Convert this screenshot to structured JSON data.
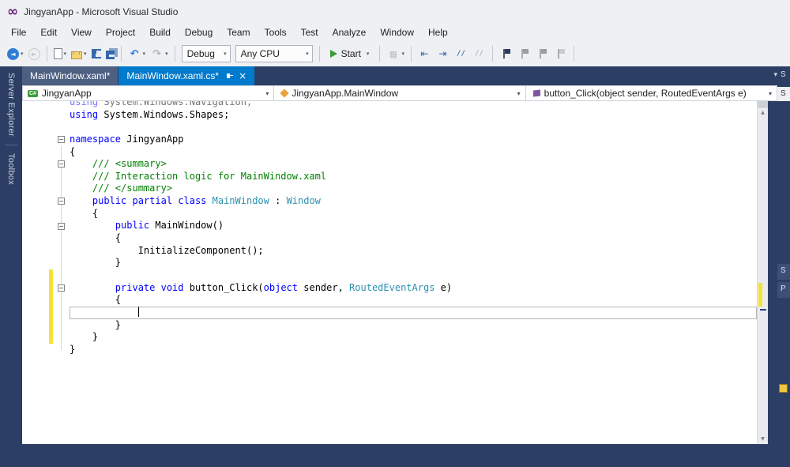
{
  "window": {
    "title": "JingyanApp - Microsoft Visual Studio"
  },
  "menu": {
    "items": [
      "File",
      "Edit",
      "View",
      "Project",
      "Build",
      "Debug",
      "Team",
      "Tools",
      "Test",
      "Analyze",
      "Window",
      "Help"
    ]
  },
  "icons": {
    "vs_logo": "∞",
    "chevron_down": "▾",
    "close": "×",
    "up_arrow": "▲",
    "down_arrow": "▼",
    "back_arrow": "◄",
    "forward_arrow": "►",
    "undo_arrow": "↶",
    "redo_arrow": "↷",
    "grid": "▦",
    "indent_left": "⇤",
    "indent_right": "⇥",
    "comment": "//"
  },
  "toolbar": {
    "items": [
      {
        "type": "icon",
        "name": "navigate-back-button",
        "icon": "circle-back",
        "caret": true
      },
      {
        "type": "icon",
        "name": "navigate-forward-button",
        "icon": "circle-forward",
        "disabled": true
      },
      {
        "type": "sep"
      },
      {
        "type": "icon",
        "name": "new-file-button",
        "icon": "page",
        "caret": true
      },
      {
        "type": "icon",
        "name": "open-file-button",
        "icon": "folder",
        "caret": true
      },
      {
        "type": "icon",
        "name": "save-button",
        "icon": "floppy"
      },
      {
        "type": "icon",
        "name": "save-all-button",
        "icon": "floppy-all"
      },
      {
        "type": "sep"
      },
      {
        "type": "icon",
        "name": "undo-button",
        "icon": "undo",
        "caret": true
      },
      {
        "type": "icon",
        "name": "redo-button",
        "icon": "redo",
        "disabled": true,
        "caret": true
      },
      {
        "type": "sep"
      },
      {
        "type": "combo",
        "name": "solution-configurations-combo",
        "value": "Debug",
        "width": 62
      },
      {
        "type": "combo",
        "name": "solution-platforms-combo",
        "value": "Any CPU",
        "width": 98
      },
      {
        "type": "sep"
      },
      {
        "type": "start",
        "name": "start-debug-button",
        "label": "Start"
      },
      {
        "type": "sep"
      },
      {
        "type": "icon",
        "name": "intellisense-button",
        "icon": "grid",
        "disabled": true,
        "caret": true
      },
      {
        "type": "sep"
      },
      {
        "type": "icon",
        "name": "indent-decrease-button",
        "icon": "indent-left"
      },
      {
        "type": "icon",
        "name": "indent-increase-button",
        "icon": "indent-right"
      },
      {
        "type": "icon",
        "name": "comment-button",
        "icon": "comment"
      },
      {
        "type": "icon",
        "name": "uncomment-button",
        "icon": "uncomment",
        "disabled": true
      },
      {
        "type": "sep"
      },
      {
        "type": "icon",
        "name": "bookmark-toggle-button",
        "icon": "flag"
      },
      {
        "type": "icon",
        "name": "bookmark-prev-button",
        "icon": "flag",
        "disabled": true
      },
      {
        "type": "icon",
        "name": "bookmark-next-button",
        "icon": "flag",
        "disabled": true
      },
      {
        "type": "icon",
        "name": "bookmark-clear-button",
        "icon": "flag-x",
        "disabled": true
      },
      {
        "type": "sep"
      }
    ]
  },
  "tabs": [
    {
      "label": "MainWindow.xaml*",
      "active": false
    },
    {
      "label": "MainWindow.xaml.cs*",
      "active": true
    }
  ],
  "navbar": {
    "project": "JingyanApp",
    "type": "JingyanApp.MainWindow",
    "member": "button_Click(object sender, RoutedEventArgs e)"
  },
  "left_tabs": [
    "Server Explorer",
    "Toolbox"
  ],
  "right_edge": {
    "frag1": "S",
    "frag2": "S",
    "frag3": "S",
    "frag4": "P"
  },
  "editor": {
    "colors": {
      "keyword": "#0000ff",
      "type": "#2b91af",
      "comment": "#008000",
      "plain": "#000000",
      "changed_bar": "#f5e137",
      "active_tab": "#007acc",
      "inactive_tab": "#4d6082",
      "background": "#2c3e63"
    },
    "lines": [
      {
        "dim": true,
        "tokens": [
          [
            "kw",
            "using"
          ],
          [
            "pl",
            " System.Windows.Navigation;"
          ]
        ]
      },
      {
        "tokens": [
          [
            "kw",
            "using"
          ],
          [
            "pl",
            " System.Windows.Shapes;"
          ]
        ]
      },
      {
        "tokens": []
      },
      {
        "fold": true,
        "tokens": [
          [
            "kw",
            "namespace"
          ],
          [
            "pl",
            " JingyanApp"
          ]
        ]
      },
      {
        "tokens": [
          [
            "pl",
            "{"
          ]
        ]
      },
      {
        "fold": true,
        "tokens": [
          [
            "cm",
            "    /// <summary>"
          ]
        ]
      },
      {
        "tokens": [
          [
            "cm",
            "    /// Interaction logic for MainWindow.xaml"
          ]
        ]
      },
      {
        "tokens": [
          [
            "cm",
            "    /// </summary>"
          ]
        ]
      },
      {
        "fold": true,
        "tokens": [
          [
            "kw",
            "    public partial class "
          ],
          [
            "ty",
            "MainWindow"
          ],
          [
            "pl",
            " : "
          ],
          [
            "ty",
            "Window"
          ]
        ]
      },
      {
        "tokens": [
          [
            "pl",
            "    {"
          ]
        ]
      },
      {
        "fold": true,
        "tokens": [
          [
            "kw",
            "        public"
          ],
          [
            "pl",
            " MainWindow()"
          ]
        ]
      },
      {
        "tokens": [
          [
            "pl",
            "        {"
          ]
        ]
      },
      {
        "tokens": [
          [
            "pl",
            "            InitializeComponent();"
          ]
        ]
      },
      {
        "tokens": [
          [
            "pl",
            "        }"
          ]
        ]
      },
      {
        "changed": true,
        "tokens": []
      },
      {
        "fold": true,
        "changed": true,
        "tokens": [
          [
            "kw",
            "        private void"
          ],
          [
            "pl",
            " button_Click("
          ],
          [
            "kw",
            "object"
          ],
          [
            "pl",
            " sender, "
          ],
          [
            "ty",
            "RoutedEventArgs"
          ],
          [
            "pl",
            " e)"
          ]
        ]
      },
      {
        "changed": true,
        "tokens": [
          [
            "pl",
            "        {"
          ]
        ]
      },
      {
        "changed": true,
        "current": true,
        "caret": true,
        "tokens": [
          [
            "pl",
            "            "
          ]
        ]
      },
      {
        "changed": true,
        "tokens": [
          [
            "pl",
            "        }"
          ]
        ]
      },
      {
        "changed": true,
        "tokens": [
          [
            "pl",
            "    }"
          ]
        ]
      },
      {
        "tokens": [
          [
            "pl",
            "}"
          ]
        ]
      }
    ]
  }
}
